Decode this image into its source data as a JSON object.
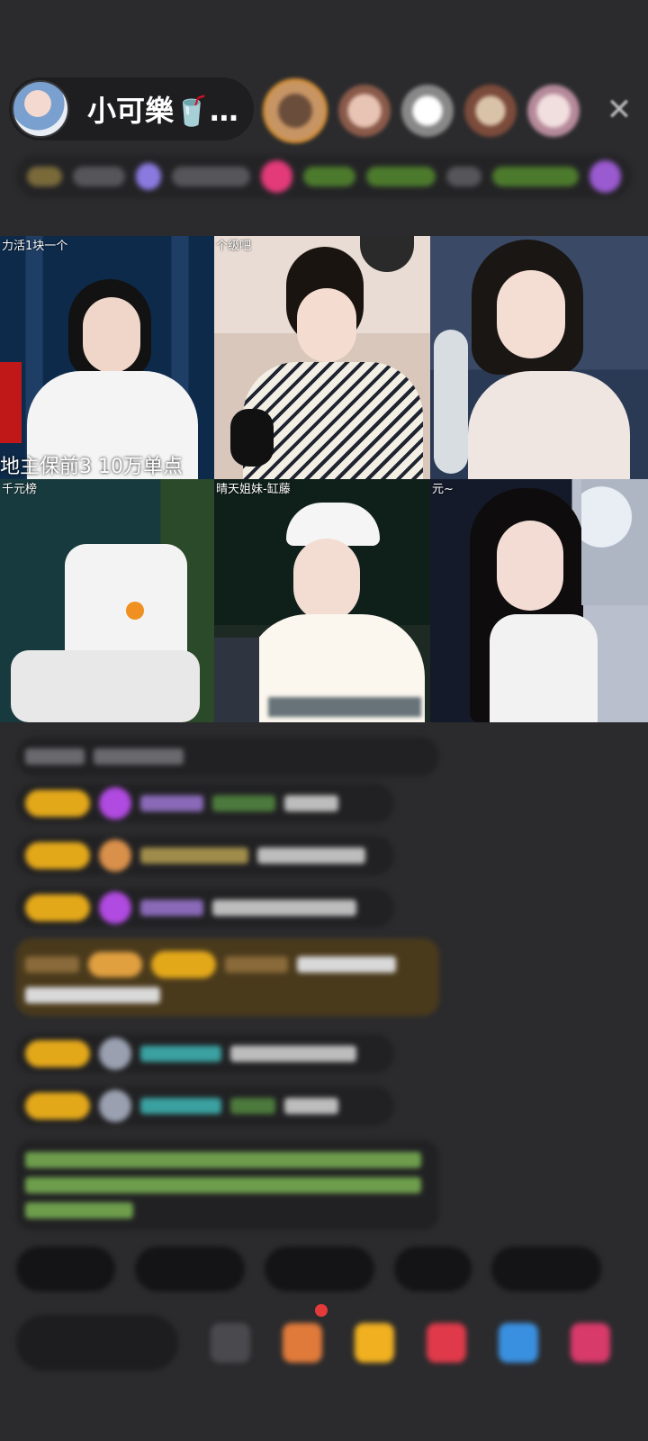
{
  "header": {
    "host_name": "小可樂🥤…",
    "close_icon": "close-icon"
  },
  "grid": {
    "cells": [
      {
        "label": "力活1块一个",
        "caption": "地主保前3 10万单点"
      },
      {
        "label": "个级吧",
        "caption": ""
      },
      {
        "label": "",
        "caption": ""
      },
      {
        "label": "千元榜",
        "caption": ""
      },
      {
        "label": "晴天姐妹-缸藤",
        "caption": ""
      },
      {
        "label": "元~",
        "caption": ""
      }
    ]
  },
  "colors": {
    "background": "#2b2b2d",
    "badge_gold": "#e3a81a",
    "chat_green": "#8fd16a",
    "notice_bg": "#4a3a1c"
  }
}
